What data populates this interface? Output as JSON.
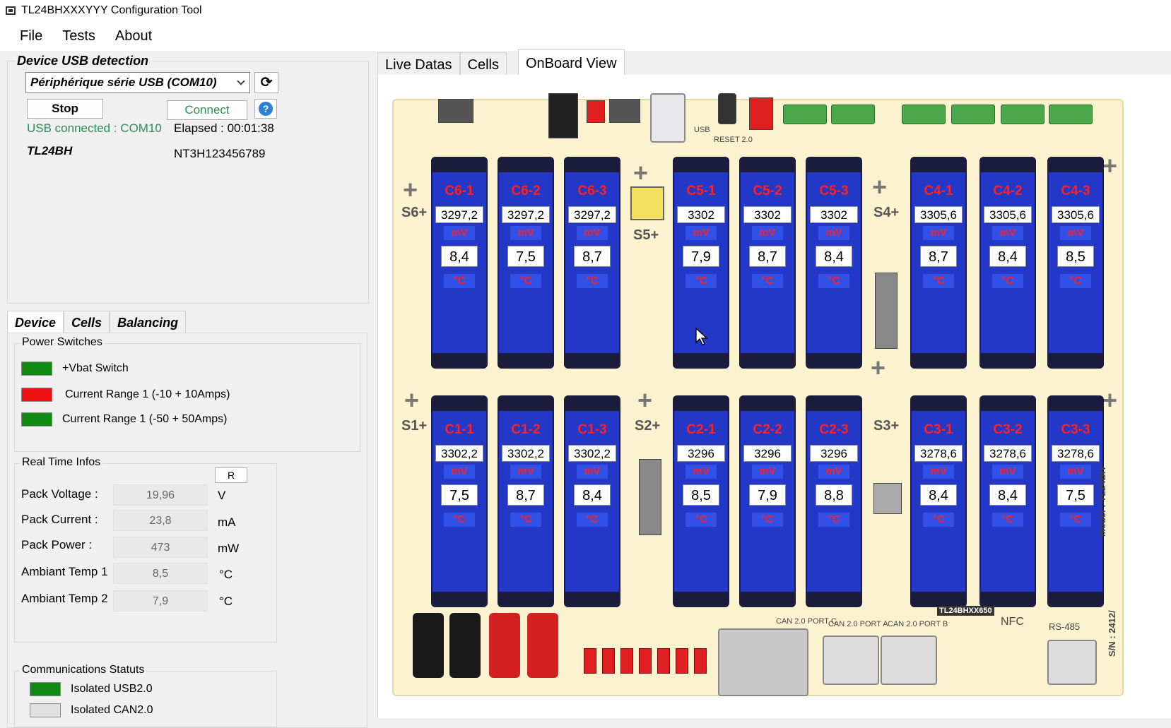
{
  "window": {
    "title": "TL24BHXXXYYY Configuration Tool"
  },
  "menu": [
    "File",
    "Tests",
    "About"
  ],
  "usb": {
    "legend": "Device USB detection",
    "port_value": "Périphérique série USB (COM10)",
    "stop_label": "Stop",
    "connect_label": "Connect",
    "status": "USB connected : COM10",
    "elapsed": "Elapsed : 00:01:38",
    "device_model": "TL24BH",
    "serial": "NT3H123456789"
  },
  "left_tabs": [
    "Device",
    "Cells",
    "Balancing"
  ],
  "power_switches": {
    "legend": "Power Switches",
    "items": [
      {
        "label": "+Vbat Switch",
        "color": "#108a10"
      },
      {
        "label": "Current Range 1 (-10 + 10Amps)",
        "color": "#ee1111"
      },
      {
        "label": "Current Range 1 (-50 + 50Amps)",
        "color": "#108a10"
      }
    ]
  },
  "realtime": {
    "legend": "Real Time Infos",
    "r_button": "R",
    "rows": [
      {
        "label": "Pack Voltage :",
        "value": "19,96",
        "unit": "V"
      },
      {
        "label": "Pack Current :",
        "value": "23,8",
        "unit": "mA"
      },
      {
        "label": "Pack Power :",
        "value": "473",
        "unit": "mW"
      },
      {
        "label": "Ambiant Temp 1",
        "value": "8,5",
        "unit": "°C"
      },
      {
        "label": "Ambiant Temp 2",
        "value": "7,9",
        "unit": "°C"
      }
    ]
  },
  "comms": {
    "legend": "Communications Statuts",
    "items": [
      {
        "label": "Isolated USB2.0",
        "color": "#108a10"
      },
      {
        "label": "Isolated CAN2.0",
        "color": "#e0e0e0"
      }
    ]
  },
  "right_tabs": [
    "Live Datas",
    "Cells",
    "OnBoard View"
  ],
  "board": {
    "volt_unit": "mV",
    "temp_unit": "°C",
    "top_row": [
      {
        "name": "C6-1",
        "mv": "3297,2",
        "temp": "8,4"
      },
      {
        "name": "C6-2",
        "mv": "3297,2",
        "temp": "7,5"
      },
      {
        "name": "C6-3",
        "mv": "3297,2",
        "temp": "8,7"
      },
      {
        "name": "C5-1",
        "mv": "3302",
        "temp": "7,9"
      },
      {
        "name": "C5-2",
        "mv": "3302",
        "temp": "8,7"
      },
      {
        "name": "C5-3",
        "mv": "3302",
        "temp": "8,4"
      },
      {
        "name": "C4-1",
        "mv": "3305,6",
        "temp": "8,7"
      },
      {
        "name": "C4-2",
        "mv": "3305,6",
        "temp": "8,4"
      },
      {
        "name": "C4-3",
        "mv": "3305,6",
        "temp": "8,5"
      }
    ],
    "bottom_row": [
      {
        "name": "C1-1",
        "mv": "3302,2",
        "temp": "7,5"
      },
      {
        "name": "C1-2",
        "mv": "3302,2",
        "temp": "8,7"
      },
      {
        "name": "C1-3",
        "mv": "3302,2",
        "temp": "8,4"
      },
      {
        "name": "C2-1",
        "mv": "3296",
        "temp": "8,5"
      },
      {
        "name": "C2-2",
        "mv": "3296",
        "temp": "7,9"
      },
      {
        "name": "C2-3",
        "mv": "3296",
        "temp": "8,8"
      },
      {
        "name": "C3-1",
        "mv": "3278,6",
        "temp": "8,4"
      },
      {
        "name": "C3-2",
        "mv": "3278,6",
        "temp": "8,4"
      },
      {
        "name": "C3-3",
        "mv": "3278,6",
        "temp": "7,5"
      }
    ],
    "stack_labels": {
      "s6": "S6+",
      "s5": "S5+",
      "s4": "S4+",
      "s1": "S1+",
      "s2": "S2+",
      "s3": "S3+"
    },
    "silk": {
      "can_c": "CAN 2.0 PORT C",
      "can_a": "CAN 2.0 PORT A",
      "can_b": "CAN 2.0 PORT B",
      "model_tag": "TL24BHXX650",
      "nfc": "NFC",
      "rs485": "RS-485",
      "model_side": "Model : TL24BH",
      "sn_side": "S/N : 2412/",
      "usb": "USB",
      "reset": "RESET 2.0"
    }
  }
}
